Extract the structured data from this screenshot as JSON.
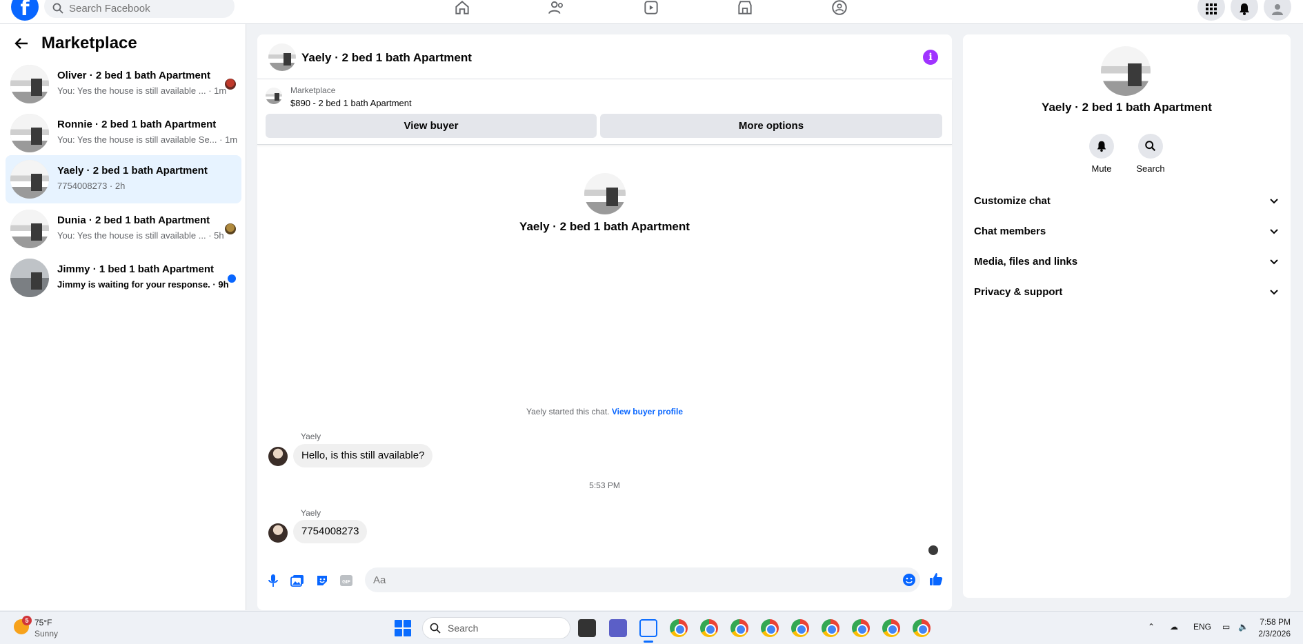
{
  "topbar": {
    "search_placeholder": "Search Facebook"
  },
  "sidebar": {
    "title": "Marketplace",
    "conversations": [
      {
        "name": "Oliver · 2 bed 1 bath Apartment",
        "preview": "You: Yes the house is still available ... · 1m",
        "unread": false
      },
      {
        "name": "Ronnie · 2 bed 1 bath Apartment",
        "preview": "You: Yes the house is still available Se... · 1m",
        "unread": false
      },
      {
        "name": "Yaely · 2 bed 1 bath Apartment",
        "preview": "7754008273 · 2h",
        "unread": false
      },
      {
        "name": "Dunia · 2 bed 1 bath Apartment",
        "preview": "You: Yes the house is still available ... · 5h",
        "unread": false
      },
      {
        "name": "Jimmy · 1 bed 1 bath Apartment",
        "preview": "Jimmy is waiting for your response. · 9h",
        "unread": true
      }
    ]
  },
  "chat": {
    "title": "Yaely · 2 bed 1 bath Apartment",
    "marketplace_label": "Marketplace",
    "listing": "$890 - 2 bed 1 bath Apartment",
    "view_buyer": "View buyer",
    "more_options": "More options",
    "profile_name": "Yaely · 2 bed 1 bath Apartment",
    "started_text": "Yaely started this chat.",
    "view_buyer_profile": "View buyer profile",
    "messages": [
      {
        "sender": "Yaely",
        "text": "Hello, is this still available?"
      },
      {
        "sender": "Yaely",
        "text": "7754008273"
      }
    ],
    "timestamp": "5:53 PM",
    "composer_placeholder": "Aa",
    "info_glyph": "i"
  },
  "right_panel": {
    "name": "Yaely · 2 bed 1 bath Apartment",
    "actions": [
      {
        "label": "Mute",
        "icon": "bell-icon"
      },
      {
        "label": "Search",
        "icon": "search-icon"
      }
    ],
    "sections": [
      "Customize chat",
      "Chat members",
      "Media, files and links",
      "Privacy & support"
    ]
  },
  "taskbar": {
    "weather_temp": "75°F",
    "weather_desc": "Sunny",
    "weather_badge": "5",
    "search_label": "Search",
    "lang": "ENG",
    "time": "7:58 PM",
    "date": "2/3/2026"
  },
  "colors": {
    "accent": "#0866ff",
    "info": "#a033ff",
    "active_row": "#e7f3ff"
  }
}
